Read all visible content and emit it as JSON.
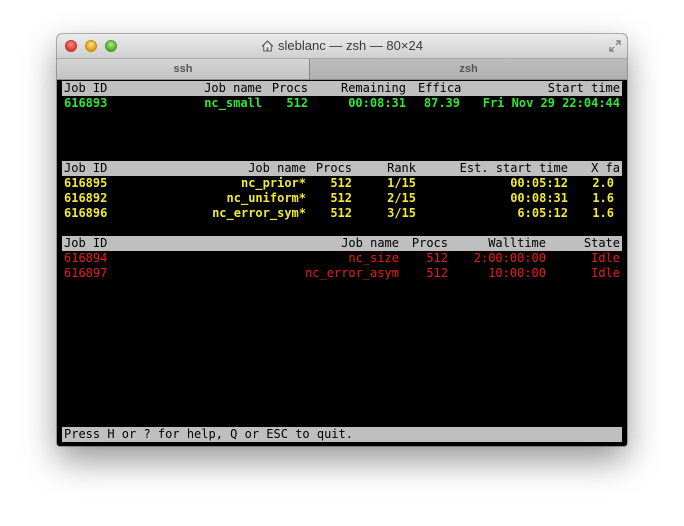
{
  "window": {
    "title": "sleblanc — zsh — 80×24",
    "tabs": [
      {
        "label": "ssh"
      },
      {
        "label": "zsh"
      }
    ]
  },
  "running": {
    "headers": [
      "Job ID",
      "Job name",
      "Procs",
      "Remaining",
      "Effica",
      "Start time"
    ],
    "rows": [
      {
        "job_id": "616893",
        "job_name": "nc_small",
        "procs": "512",
        "remaining": "00:08:31",
        "efficacy": "87.39",
        "start_time": "Fri Nov 29 22:04:44"
      }
    ],
    "color": "#30e63a"
  },
  "eligible": {
    "headers": [
      "Job ID",
      "Job name",
      "Procs",
      "Rank",
      "Est. start time",
      "X fa"
    ],
    "rows": [
      {
        "job_id": "616895",
        "job_name": "nc_prior*",
        "procs": "512",
        "rank": "1/15",
        "est_start": "00:05:12",
        "xfactor": "2.0"
      },
      {
        "job_id": "616892",
        "job_name": "nc_uniform*",
        "procs": "512",
        "rank": "2/15",
        "est_start": "00:08:31",
        "xfactor": "1.6"
      },
      {
        "job_id": "616896",
        "job_name": "nc_error_sym*",
        "procs": "512",
        "rank": "3/15",
        "est_start": "6:05:12",
        "xfactor": "1.6"
      }
    ],
    "color": "#f2ea35"
  },
  "blocked": {
    "headers": [
      "Job ID",
      "Job name",
      "Procs",
      "Walltime",
      "State"
    ],
    "rows": [
      {
        "job_id": "616894",
        "job_name": "nc_size",
        "procs": "512",
        "walltime": "2:00:00:00",
        "state": "Idle"
      },
      {
        "job_id": "616897",
        "job_name": "nc_error_asym",
        "procs": "512",
        "walltime": "10:00:00",
        "state": "Idle"
      }
    ],
    "color": "#ee1a1a"
  },
  "footer": {
    "text": "Press H or ? for help, Q or ESC to quit."
  }
}
